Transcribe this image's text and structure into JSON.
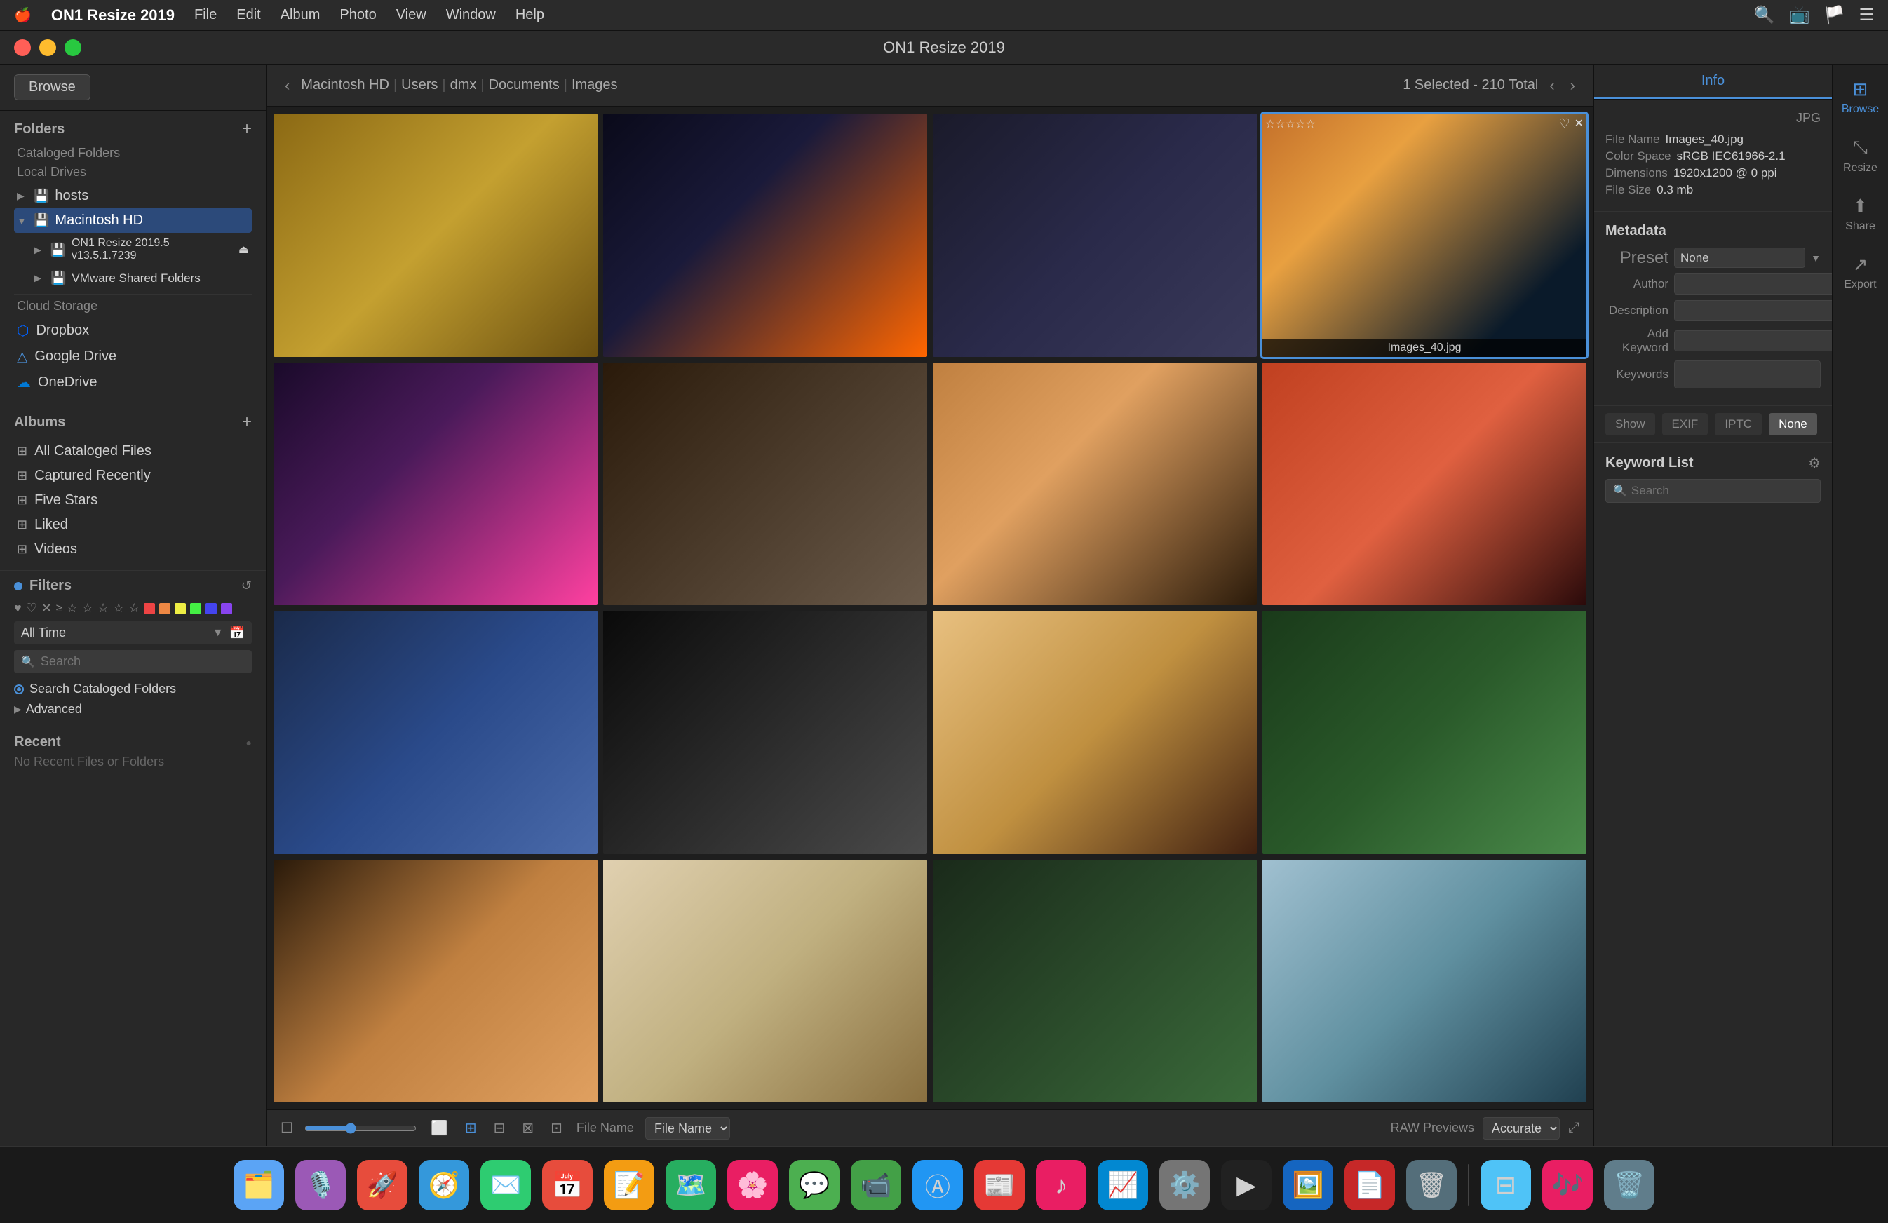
{
  "menubar": {
    "apple": "🍎",
    "app_name": "ON1 Resize 2019",
    "menus": [
      "File",
      "Edit",
      "Album",
      "Photo",
      "View",
      "Window",
      "Help"
    ]
  },
  "titlebar": {
    "title": "ON1 Resize 2019",
    "traffic_lights": [
      "red",
      "yellow",
      "green"
    ]
  },
  "sidebar": {
    "browse_label": "Browse",
    "folders_title": "Folders",
    "cataloged_folders_label": "Cataloged Folders",
    "local_drives_label": "Local Drives",
    "hosts_label": "hosts",
    "macintosh_hd_label": "Macintosh HD",
    "on1_label": "ON1 Resize 2019.5 v13.5.1.7239",
    "vmware_label": "VMware Shared Folders",
    "cloud_storage_label": "Cloud Storage",
    "dropbox_label": "Dropbox",
    "google_drive_label": "Google Drive",
    "onedrive_label": "OneDrive",
    "albums_title": "Albums",
    "all_cataloged_label": "All Cataloged Files",
    "captured_recently_label": "Captured Recently",
    "five_stars_label": "Five Stars",
    "liked_label": "Liked",
    "videos_label": "Videos",
    "filters_title": "Filters",
    "all_time_label": "All Time",
    "search_placeholder": "Search",
    "search_cataloged_label": "Search Cataloged Folders",
    "advanced_label": "Advanced",
    "recent_title": "Recent",
    "no_recent_label": "No Recent Files or Folders"
  },
  "navbar": {
    "back_arrow": "‹",
    "breadcrumb": [
      "Macintosh HD",
      "Users",
      "dmx",
      "Documents",
      "Images"
    ],
    "breadcrumb_sep": "|",
    "selection_info": "1 Selected - 210 Total",
    "prev_arrow": "‹",
    "next_arrow": "›"
  },
  "photos": [
    {
      "id": 1,
      "label": "",
      "color_class": "photo-1",
      "selected": false
    },
    {
      "id": 2,
      "label": "",
      "color_class": "photo-2",
      "selected": false
    },
    {
      "id": 3,
      "label": "",
      "color_class": "photo-3",
      "selected": false
    },
    {
      "id": 4,
      "label": "Images_40.jpg",
      "color_class": "photo-4",
      "selected": true
    },
    {
      "id": 5,
      "label": "",
      "color_class": "photo-5",
      "selected": false
    },
    {
      "id": 6,
      "label": "",
      "color_class": "photo-6",
      "selected": false
    },
    {
      "id": 7,
      "label": "",
      "color_class": "photo-7",
      "selected": false
    },
    {
      "id": 8,
      "label": "",
      "color_class": "photo-8",
      "selected": false
    },
    {
      "id": 9,
      "label": "",
      "color_class": "photo-9",
      "selected": false
    },
    {
      "id": 10,
      "label": "",
      "color_class": "photo-10",
      "selected": false
    },
    {
      "id": 11,
      "label": "",
      "color_class": "photo-11",
      "selected": false
    },
    {
      "id": 12,
      "label": "",
      "color_class": "photo-12",
      "selected": false
    },
    {
      "id": 13,
      "label": "",
      "color_class": "photo-13",
      "selected": false
    },
    {
      "id": 14,
      "label": "",
      "color_class": "photo-14",
      "selected": false
    },
    {
      "id": 15,
      "label": "",
      "color_class": "photo-15",
      "selected": false
    },
    {
      "id": 16,
      "label": "",
      "color_class": "photo-16",
      "selected": false
    }
  ],
  "info_panel": {
    "tab_info": "Info",
    "filetype": "JPG",
    "file_name_label": "File Name",
    "file_name_value": "Images_40.jpg",
    "color_space_label": "Color Space",
    "color_space_value": "sRGB IEC61966-2.1",
    "dimensions_label": "Dimensions",
    "dimensions_value": "1920x1200 @ 0 ppi",
    "file_size_label": "File Size",
    "file_size_value": "0.3 mb",
    "metadata_title": "Metadata",
    "preset_label": "Preset",
    "preset_value": "None",
    "author_label": "Author",
    "description_label": "Description",
    "add_keyword_label": "Add Keyword",
    "keywords_label": "Keywords",
    "show_label": "Show",
    "exif_label": "EXIF",
    "iptc_label": "IPTC",
    "none_label": "None",
    "keyword_list_title": "Keyword List",
    "keyword_search_placeholder": "Search"
  },
  "bottom_toolbar": {
    "file_name_label": "File Name",
    "raw_previews_label": "RAW Previews",
    "accurate_label": "Accurate"
  },
  "far_right": {
    "browse_label": "Browse",
    "resize_label": "Resize",
    "share_label": "Share",
    "export_label": "Export"
  },
  "dock": {
    "items": [
      {
        "name": "finder",
        "emoji": "🗂️",
        "color": "#5ba4f5"
      },
      {
        "name": "siri",
        "emoji": "🎙️",
        "color": "#5ba4f5"
      },
      {
        "name": "launchpad",
        "emoji": "🚀",
        "color": "#e44"
      },
      {
        "name": "safari",
        "emoji": "🧭",
        "color": "#5ba4f5"
      },
      {
        "name": "mail",
        "emoji": "✉️",
        "color": "#48a"
      },
      {
        "name": "calendar",
        "emoji": "📅",
        "color": "#e44"
      },
      {
        "name": "notes",
        "emoji": "📝",
        "color": "#f90"
      },
      {
        "name": "maps",
        "emoji": "🗺️",
        "color": "#5b5"
      },
      {
        "name": "photos",
        "emoji": "🌸",
        "color": "#f5a"
      },
      {
        "name": "messages",
        "emoji": "💬",
        "color": "#5c5"
      },
      {
        "name": "facetime",
        "emoji": "📹",
        "color": "#5c5"
      },
      {
        "name": "appstore",
        "emoji": "🅰️",
        "color": "#48a"
      },
      {
        "name": "news",
        "emoji": "📰",
        "color": "#e44"
      },
      {
        "name": "music",
        "emoji": "🎵",
        "color": "#e44"
      },
      {
        "name": "stocks",
        "emoji": "📈",
        "color": "#5c5"
      },
      {
        "name": "systemprefs",
        "emoji": "⚙️",
        "color": "#888"
      },
      {
        "name": "terminal",
        "emoji": "▶",
        "color": "#333"
      },
      {
        "name": "preview",
        "emoji": "🖼️",
        "color": "#48a"
      },
      {
        "name": "acrobat",
        "emoji": "📄",
        "color": "#e44"
      },
      {
        "name": "finder2",
        "emoji": "🗃️",
        "color": "#888"
      },
      {
        "name": "spotify",
        "emoji": "🎶",
        "color": "#1db954"
      },
      {
        "name": "trash",
        "emoji": "🗑️",
        "color": "#888"
      }
    ]
  }
}
